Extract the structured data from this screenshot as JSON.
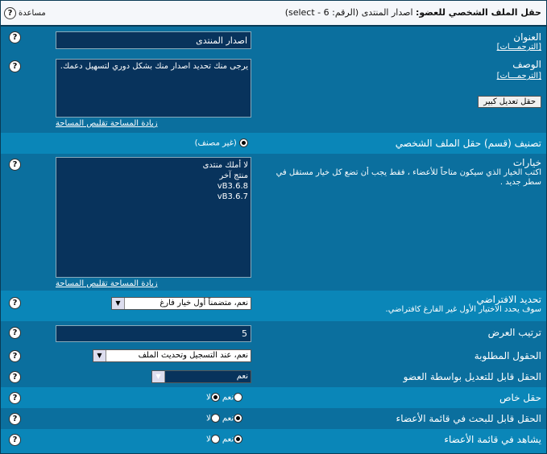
{
  "header": {
    "title_prefix": "حقل الملف الشخصي للعضو:",
    "title_value": "اصدار المنتدى (الرقم: 6 - select)",
    "help_label": "مساعدة"
  },
  "fields": {
    "title": {
      "label": "العنوان",
      "translations": "[الترجمـــات]",
      "value": "اصدار المنتدى"
    },
    "description": {
      "label": "الوصف",
      "translations": "[الترجمـــات]",
      "value": "يرجى منك تحديد اصدار منك بشكل دوري لتسهيل دعمك.",
      "increase": "زيادة المساحة",
      "decrease": "تقليص المساحة",
      "big_edit_button": "حقل تعديل كبير"
    },
    "category": {
      "label": "تصنيف (قسم) حقل الملف الشخصي",
      "option": "(غير مصنف)"
    },
    "options": {
      "label": "خيارات",
      "description": "اكتب الخيار الذي سيكون متاحاً للأعضاء ، فقط يجب أن تضع كل خيار مستقل في سطر جديد .",
      "lines": [
        "لا أملك منتدى",
        "منتج آخر",
        "vB3.6.8",
        "vB3.6.7"
      ],
      "increase": "زيادة المساحة",
      "decrease": "تقليص المساحة"
    },
    "default": {
      "label": "تحديد الافتراضي",
      "description": "سوف يحدد الاختيار الأول غير الفارغ كافتراضي.",
      "selected": "نعم، متضمناً أول خيار فارغ"
    },
    "display_order": {
      "label": "ترتيب العرض",
      "value": "5"
    },
    "required": {
      "label": "الحقول المطلوبة",
      "selected": "نعم، عند التسجيل وتحديث الملف"
    },
    "editable": {
      "label": "الحقل قابل للتعديل بواسطة العضو",
      "selected": "نعم"
    },
    "private": {
      "label": "حقل خاص",
      "yes": "نعم",
      "no": "لا",
      "checked": "no"
    },
    "searchable": {
      "label": "الحقل قابل للبحث في قائمة الأعضاء",
      "yes": "نعم",
      "no": "لا",
      "checked": "yes"
    },
    "memberlist": {
      "label": "يشاهد في قائمة الأعضاء",
      "yes": "نعم",
      "no": "لا",
      "checked": "yes"
    }
  },
  "icons": {
    "help": "?"
  },
  "colors": {
    "background": "#0b6f9e",
    "alt_row": "#0a86b8",
    "input_bg": "#08335c",
    "header_bg": "#f5f7fa"
  }
}
